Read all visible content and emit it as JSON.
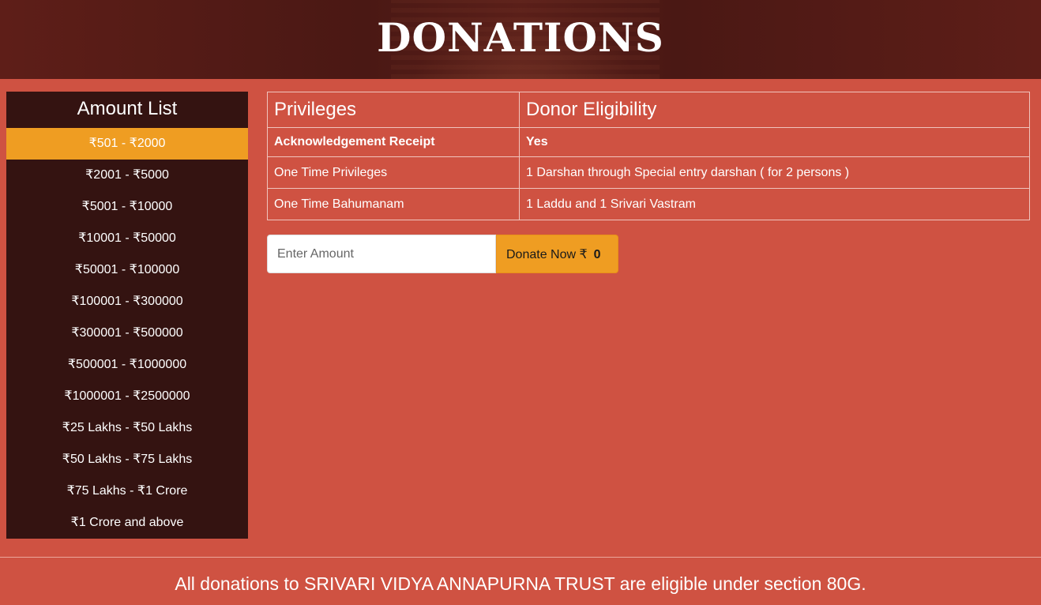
{
  "header": {
    "title": "DONATIONS"
  },
  "sidebar": {
    "title": "Amount List",
    "items": [
      {
        "label": "₹501 - ₹2000",
        "active": true
      },
      {
        "label": "₹2001 - ₹5000"
      },
      {
        "label": "₹5001 - ₹10000"
      },
      {
        "label": "₹10001 - ₹50000"
      },
      {
        "label": "₹50001 - ₹100000"
      },
      {
        "label": "₹100001 - ₹300000"
      },
      {
        "label": "₹300001 - ₹500000"
      },
      {
        "label": "₹500001 - ₹1000000"
      },
      {
        "label": "₹1000001 - ₹2500000"
      },
      {
        "label": "₹25 Lakhs - ₹50 Lakhs"
      },
      {
        "label": "₹50 Lakhs - ₹75 Lakhs"
      },
      {
        "label": "₹75 Lakhs - ₹1 Crore"
      },
      {
        "label": "₹1 Crore and above"
      }
    ]
  },
  "table": {
    "headers": [
      "Privileges",
      "Donor Eligibility"
    ],
    "rows": [
      [
        "Acknowledgement Receipt",
        "Yes"
      ],
      [
        "One Time Privileges",
        "1 Darshan through Special entry darshan ( for 2 persons )"
      ],
      [
        "One Time Bahumanam",
        "1 Laddu and 1 Srivari Vastram"
      ]
    ]
  },
  "donate": {
    "placeholder": "Enter Amount",
    "button_label": "Donate Now ₹",
    "amount": "0"
  },
  "footer": {
    "text": "All donations to SRIVARI VIDYA ANNAPURNA TRUST are eligible under section 80G."
  },
  "colors": {
    "page_background": "#cf5242",
    "sidebar_background": "#341311",
    "accent": "#ef9d22"
  }
}
